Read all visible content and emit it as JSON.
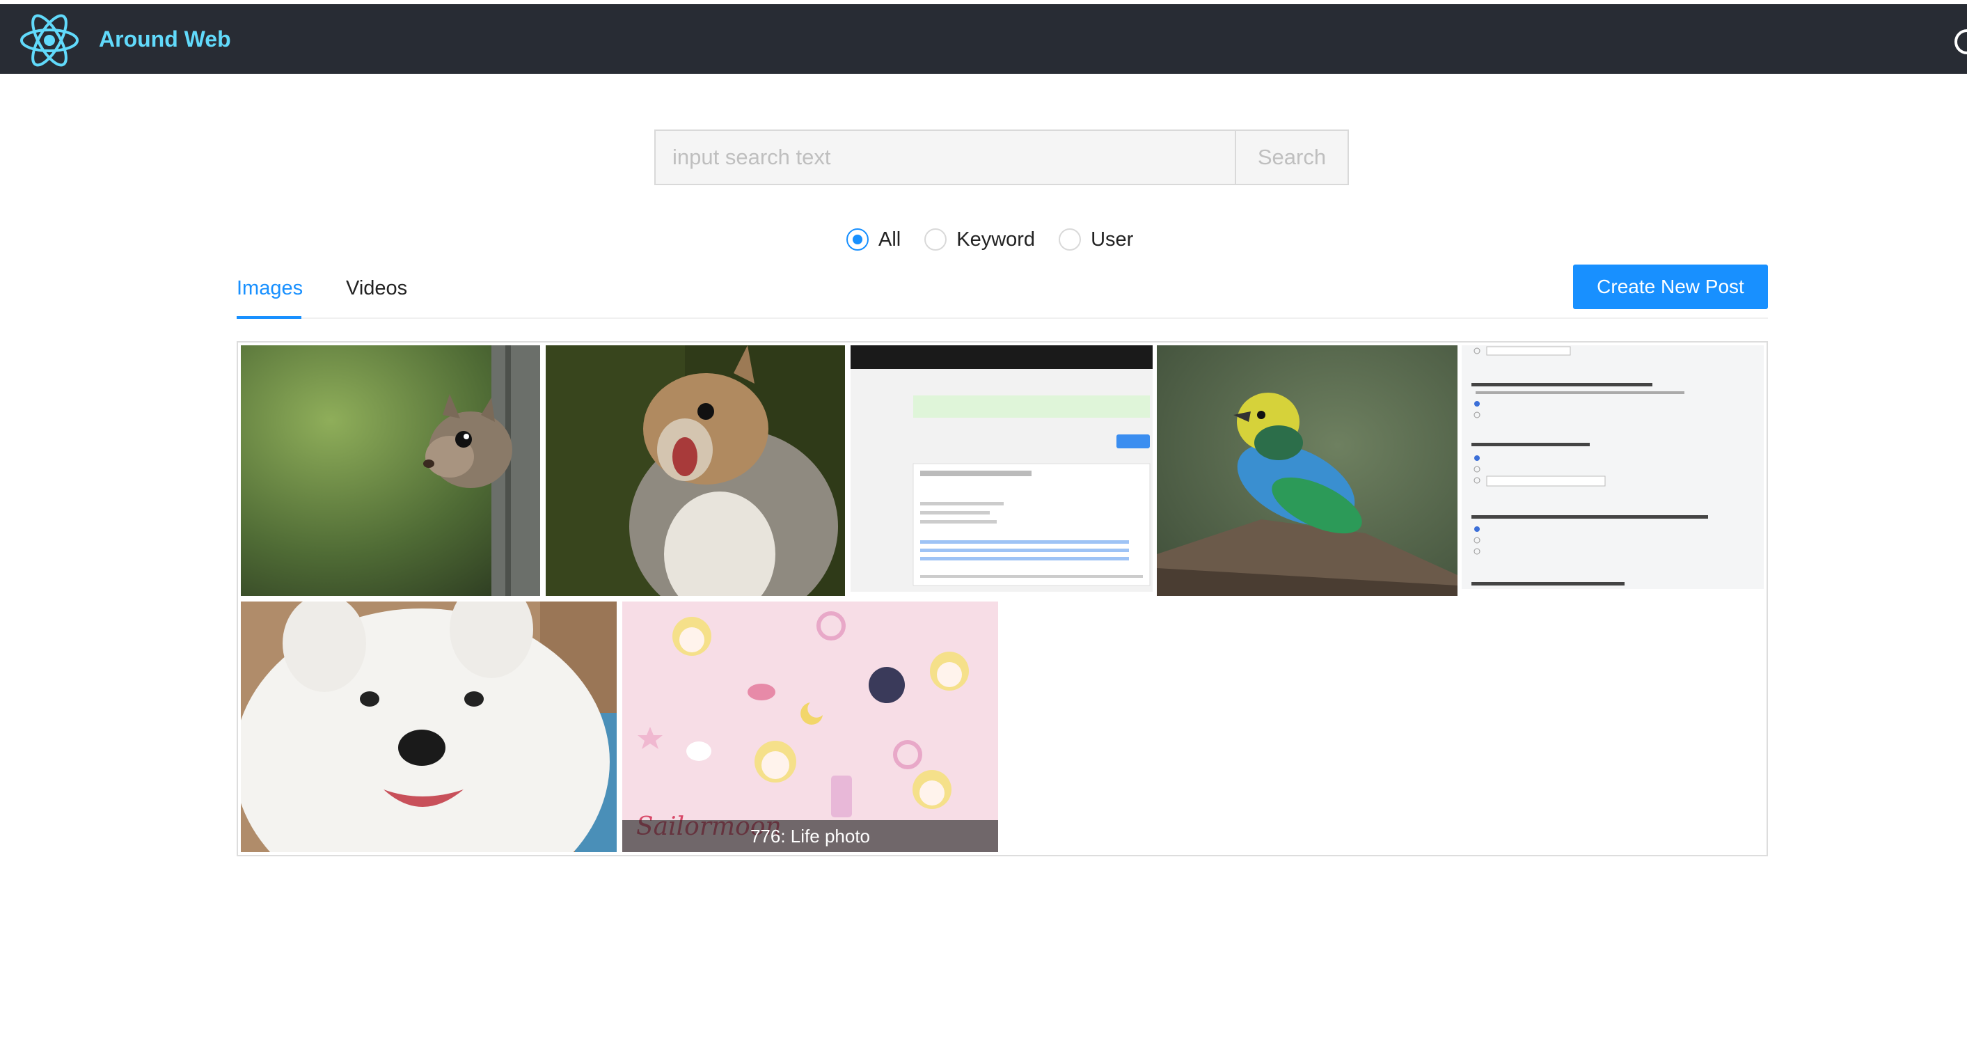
{
  "header": {
    "title": "Around Web",
    "logo_icon": "react-atom-icon",
    "logout_icon": "logout-icon",
    "colors": {
      "background": "#282c34",
      "title": "#61dafb"
    }
  },
  "search": {
    "placeholder": "input search text",
    "button_label": "Search"
  },
  "search_type": {
    "options": [
      {
        "label": "All",
        "selected": true
      },
      {
        "label": "Keyword",
        "selected": false
      },
      {
        "label": "User",
        "selected": false
      }
    ]
  },
  "tabs": [
    {
      "label": "Images",
      "active": true
    },
    {
      "label": "Videos",
      "active": false
    }
  ],
  "create_post_label": "Create New Post",
  "accent_color": "#1890ff",
  "gallery": {
    "items": [
      {
        "subject": "squirrel peeking from tree"
      },
      {
        "subject": "squirrel with open mouth"
      },
      {
        "subject": "license screenshot"
      },
      {
        "subject": "colorful bird on branch"
      },
      {
        "subject": "form screenshot"
      },
      {
        "subject": "white samoyed dog"
      },
      {
        "subject": "sailor moon pattern",
        "caption": "776: Life photo"
      }
    ]
  }
}
